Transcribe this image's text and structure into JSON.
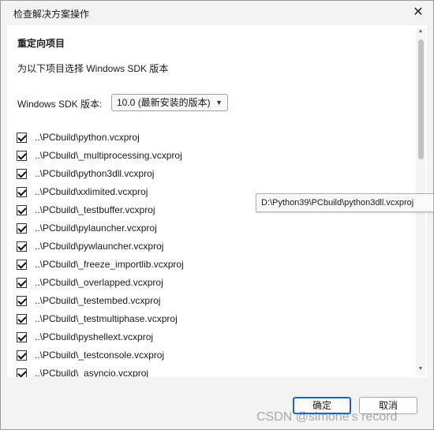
{
  "window": {
    "title": "检查解决方案操作",
    "close_glyph": "✕"
  },
  "heading": "重定向项目",
  "description": "为以下项目选择 Windows SDK 版本",
  "sdk": {
    "label": "Windows SDK 版本:",
    "selected": "10.0 (最新安装的版本)"
  },
  "projects": [
    {
      "label": "..\\PCbuild\\python.vcxproj",
      "checked": true
    },
    {
      "label": "..\\PCbuild\\_multiprocessing.vcxproj",
      "checked": true
    },
    {
      "label": "..\\PCbuild\\python3dll.vcxproj",
      "checked": true
    },
    {
      "label": "..\\PCbuild\\xxlimited.vcxproj",
      "checked": true
    },
    {
      "label": "..\\PCbuild\\_testbuffer.vcxproj",
      "checked": true
    },
    {
      "label": "..\\PCbuild\\pylauncher.vcxproj",
      "checked": true
    },
    {
      "label": "..\\PCbuild\\pywlauncher.vcxproj",
      "checked": true
    },
    {
      "label": "..\\PCbuild\\_freeze_importlib.vcxproj",
      "checked": true
    },
    {
      "label": "..\\PCbuild\\_overlapped.vcxproj",
      "checked": true
    },
    {
      "label": "..\\PCbuild\\_testembed.vcxproj",
      "checked": true
    },
    {
      "label": "..\\PCbuild\\_testmultiphase.vcxproj",
      "checked": true
    },
    {
      "label": "..\\PCbuild\\pyshellext.vcxproj",
      "checked": true
    },
    {
      "label": "..\\PCbuild\\_testconsole.vcxproj",
      "checked": true
    },
    {
      "label": "..\\PCbuild\\_asyncio.vcxproj",
      "checked": true
    }
  ],
  "tooltip": "D:\\Python39\\PCbuild\\python3dll.vcxproj",
  "buttons": {
    "ok": "确定",
    "cancel": "取消"
  },
  "watermark": "CSDN @simone's record",
  "colors": {
    "primary_border": "#1c62c8",
    "background": "#f3f3f3"
  }
}
